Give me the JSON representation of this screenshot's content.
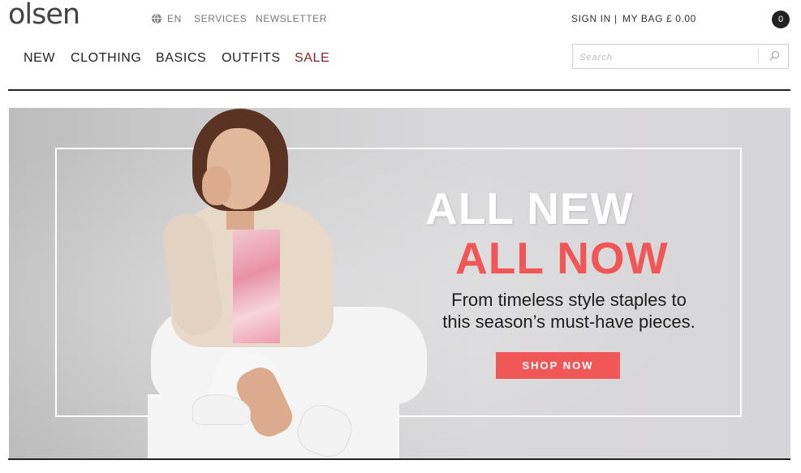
{
  "brand": {
    "logo_text": "olsen"
  },
  "utility_nav": {
    "language": "EN",
    "language_icon": "globe-icon",
    "services": "SERVICES",
    "newsletter": "NEWSLETTER"
  },
  "account": {
    "sign_in": "SIGN IN",
    "separator": "|",
    "bag": "MY BAG £ 0.00",
    "bag_count": "0"
  },
  "main_nav": {
    "items": [
      "NEW",
      "CLOTHING",
      "BASICS",
      "OUTFITS",
      "SALE"
    ]
  },
  "search": {
    "placeholder": "Search",
    "value": "",
    "icon": "search-icon"
  },
  "hero": {
    "headline_line1": "ALL NEW",
    "headline_line2": "ALL NOW",
    "tagline_line1": "From timeless style staples to",
    "tagline_line2": "this season’s must-have pieces.",
    "cta_label": "SHOP NOW",
    "accent_color": "#f05858"
  }
}
